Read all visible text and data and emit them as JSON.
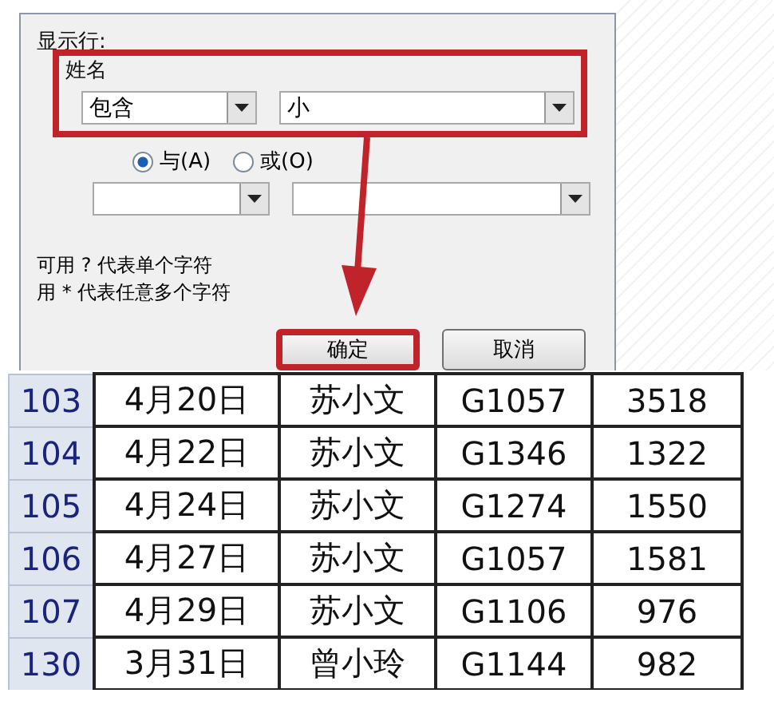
{
  "dialog": {
    "section_label": "显示行:",
    "field_label": "姓名",
    "condition_1": {
      "operator": "包含",
      "value": "小"
    },
    "logic": [
      {
        "label": "与(A)",
        "selected": true
      },
      {
        "label": "或(O)",
        "selected": false
      }
    ],
    "hints": [
      "可用 ? 代表单个字符",
      "用 * 代表任意多个字符"
    ],
    "buttons": [
      {
        "label": "确定",
        "highlighted": true
      },
      {
        "label": "取消",
        "highlighted": false
      }
    ]
  },
  "table": {
    "rows": [
      {
        "row_number": "103",
        "cells": [
          "4月20日",
          "苏小文",
          "G1057",
          "3518"
        ]
      },
      {
        "row_number": "104",
        "cells": [
          "4月22日",
          "苏小文",
          "G1346",
          "1322"
        ]
      },
      {
        "row_number": "105",
        "cells": [
          "4月24日",
          "苏小文",
          "G1274",
          "1550"
        ]
      },
      {
        "row_number": "106",
        "cells": [
          "4月27日",
          "苏小文",
          "G1057",
          "1581"
        ]
      },
      {
        "row_number": "107",
        "cells": [
          "4月29日",
          "苏小文",
          "G1106",
          "976"
        ]
      },
      {
        "row_number": "130",
        "cells": [
          "3月31日",
          "曾小玲",
          "G1144",
          "982"
        ]
      }
    ]
  }
}
